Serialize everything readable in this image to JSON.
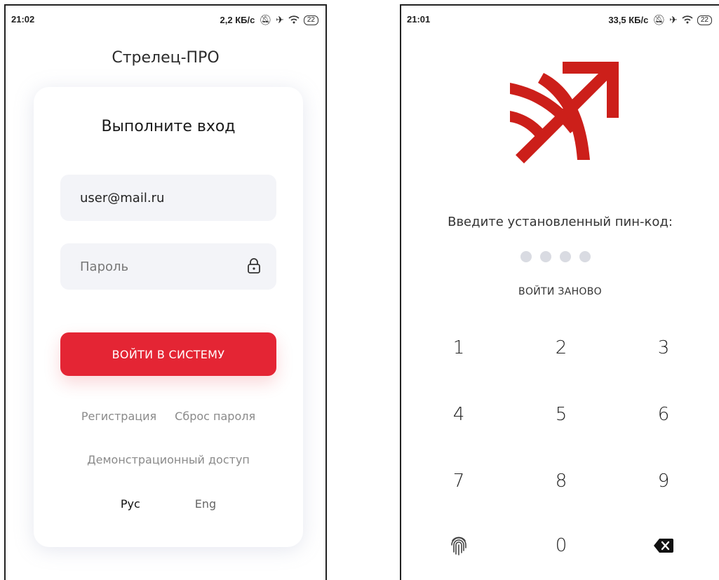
{
  "login_screen": {
    "status": {
      "time": "21:02",
      "speed": "2,2 КБ/с",
      "battery": "22"
    },
    "app_title": "Стрелец-ПРО",
    "card_title": "Выполните вход",
    "email_value": "user@mail.ru",
    "password_placeholder": "Пароль",
    "login_button": "ВОЙТИ В СИСТЕМУ",
    "register_link": "Регистрация",
    "reset_link": "Сброс пароля",
    "demo_link": "Демонстрационный доступ",
    "lang_ru": "Рус",
    "lang_en": "Eng"
  },
  "pin_screen": {
    "status": {
      "time": "21:01",
      "speed": "33,5 КБ/с",
      "battery": "22"
    },
    "prompt": "Введите установленный пин-код:",
    "relogin": "ВОЙТИ ЗАНОВО",
    "keys": [
      "1",
      "2",
      "3",
      "4",
      "5",
      "6",
      "7",
      "8",
      "9",
      "0"
    ],
    "brand_color": "#cc1f1a"
  },
  "icons": [
    "mute-icon",
    "airplane-icon",
    "wifi-icon",
    "battery-icon",
    "lock-icon",
    "logo-icon",
    "fingerprint-icon",
    "backspace-icon"
  ]
}
